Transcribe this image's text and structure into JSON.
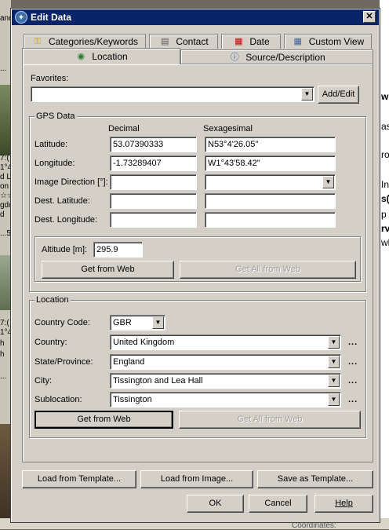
{
  "window": {
    "title": "Edit Data",
    "close_glyph": "✕"
  },
  "background_fragments": {
    "left": [
      "and",
      "d",
      "...",
      "7:(",
      "1°4",
      "d L",
      "on",
      "☆☆",
      "gdo",
      "d",
      "...5",
      "7:(",
      "1°4",
      "h",
      "h",
      "..."
    ],
    "right": [
      "w",
      "as",
      "ro",
      "In",
      "s(",
      "p",
      "rv",
      "wh"
    ],
    "bottom": "Coordinates:"
  },
  "tabs_row1": [
    {
      "label": "Categories/Keywords",
      "icon": "key-icon"
    },
    {
      "label": "Contact",
      "icon": "contact-card-icon"
    },
    {
      "label": "Date",
      "icon": "calendar-icon"
    },
    {
      "label": "Custom View",
      "icon": "grid-view-icon"
    }
  ],
  "tabs_row2": [
    {
      "label": "Location",
      "icon": "globe-icon"
    },
    {
      "label": "Source/Description",
      "icon": "info-icon"
    }
  ],
  "favorites": {
    "label": "Favorites:",
    "value": "",
    "add_edit_label": "Add/Edit"
  },
  "gps": {
    "legend": "GPS Data",
    "col_decimal": "Decimal",
    "col_sexagesimal": "Sexagesimal",
    "rows": {
      "latitude": {
        "label": "Latitude:",
        "decimal": "53.07390333",
        "sexagesimal": "N53°4'26.05\""
      },
      "longitude": {
        "label": "Longitude:",
        "decimal": "-1.73289407",
        "sexagesimal": "W1°43'58.42\""
      },
      "image_direction": {
        "label": "Image Direction [°]:",
        "decimal": "",
        "sexagesimal": ""
      },
      "dest_latitude": {
        "label": "Dest. Latitude:",
        "decimal": "",
        "sexagesimal": ""
      },
      "dest_longitude": {
        "label": "Dest. Longitude:",
        "decimal": "",
        "sexagesimal": ""
      }
    },
    "altitude_label": "Altitude [m]:",
    "altitude_value": "295.9",
    "get_from_web": "Get from Web",
    "get_all_from_web": "Get All from Web"
  },
  "location": {
    "legend": "Location",
    "country_code_label": "Country Code:",
    "country_code": "GBR",
    "country_label": "Country:",
    "country": "United Kingdom",
    "state_label": "State/Province:",
    "state": "England",
    "city_label": "City:",
    "city": "Tissington and Lea Hall",
    "sublocation_label": "Sublocation:",
    "sublocation": "Tissington",
    "ellipsis": "...",
    "get_from_web": "Get from Web",
    "get_all_from_web": "Get All from Web"
  },
  "templates": {
    "load_template": "Load from Template...",
    "load_image": "Load from Image...",
    "save_template": "Save as Template..."
  },
  "footer": {
    "ok": "OK",
    "cancel": "Cancel",
    "help": "Help"
  },
  "colors": {
    "titlebar": "#0a246a",
    "dialog_face": "#d4d0c8"
  }
}
